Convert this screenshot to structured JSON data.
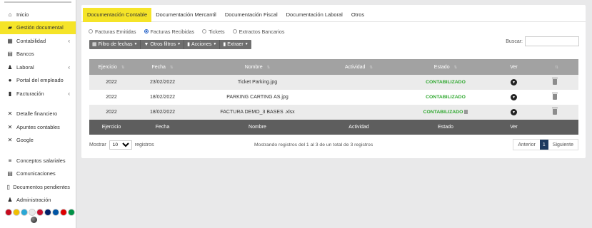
{
  "sidebar": {
    "items": [
      {
        "label": "Inicio",
        "icon": "home-icon",
        "glyph": "⌂",
        "chevron": ""
      },
      {
        "label": "Gestión documental",
        "icon": "folder-icon",
        "glyph": "▰",
        "chevron": "",
        "active": true
      },
      {
        "label": "Contabilidad",
        "icon": "calculator-icon",
        "glyph": "▦",
        "chevron": "‹"
      },
      {
        "label": "Bancos",
        "icon": "bank-icon",
        "glyph": "▤",
        "chevron": ""
      },
      {
        "label": "Laboral",
        "icon": "user-icon",
        "glyph": "♟",
        "chevron": "‹"
      },
      {
        "label": "Portal del empleado",
        "icon": "info-circle-icon",
        "glyph": "●",
        "chevron": ""
      },
      {
        "label": "Facturación",
        "icon": "invoice-icon",
        "glyph": "▮",
        "chevron": "‹"
      }
    ],
    "items2": [
      {
        "label": "Detalle financiero",
        "icon": "expand-icon",
        "glyph": "✕"
      },
      {
        "label": "Apuntes contables",
        "icon": "expand-icon",
        "glyph": "✕"
      },
      {
        "label": "Google",
        "icon": "expand-icon",
        "glyph": "✕"
      }
    ],
    "items3": [
      {
        "label": "Conceptos salariales",
        "icon": "list-icon",
        "glyph": "≡"
      },
      {
        "label": "Comunicaciones",
        "icon": "newspaper-icon",
        "glyph": "▤"
      },
      {
        "label": "Documentos pendientes",
        "icon": "file-icon",
        "glyph": "▯"
      },
      {
        "label": "Administración",
        "icon": "user-gear-icon",
        "glyph": "♟"
      }
    ],
    "flag_colors": [
      "#c60b1e",
      "#f1bf00",
      "#2aa7d5",
      "#e8e8e8",
      "#c8102e",
      "#012169",
      "#0055a4",
      "#dd0000",
      "#009246"
    ]
  },
  "tabs": [
    "Documentación Contable",
    "Documentación Mercantil",
    "Documentación Fiscal",
    "Documentación Laboral",
    "Otros"
  ],
  "radios": [
    "Facturas Emitidas",
    "Facturas Recibidas",
    "Tickets",
    "Extractos Bancarios"
  ],
  "toolbar": {
    "filter_dates": "Filtro de fechas",
    "other_filters": "Otros filtros",
    "actions": "Acciones",
    "extract": "Extraer",
    "search_label": "Buscar:"
  },
  "table": {
    "headers": [
      "Ejercicio",
      "Fecha",
      "Nombre",
      "Actividad",
      "Estado",
      "Ver"
    ],
    "rows": [
      {
        "ejercicio": "2022",
        "fecha": "23/02/2022",
        "nombre": "Ticket Parking.jpg",
        "actividad": "",
        "estado": "CONTABILIZADO"
      },
      {
        "ejercicio": "2022",
        "fecha": "18/02/2022",
        "nombre": "PARKING CARTING AS.jpg",
        "actividad": "",
        "estado": "CONTABILIZADO"
      },
      {
        "ejercicio": "2022",
        "fecha": "18/02/2022",
        "nombre": "FACTURA DEMO_3 BASES .xlsx",
        "actividad": "",
        "estado": "CONTABILIZADO"
      }
    ]
  },
  "footer": {
    "show_prefix": "Mostrar",
    "show_value": "10",
    "show_suffix": "registros",
    "info": "Mostrando registros del 1 al 3 de un total de 3 registros",
    "prev": "Anterior",
    "page": "1",
    "next": "Siguiente"
  }
}
